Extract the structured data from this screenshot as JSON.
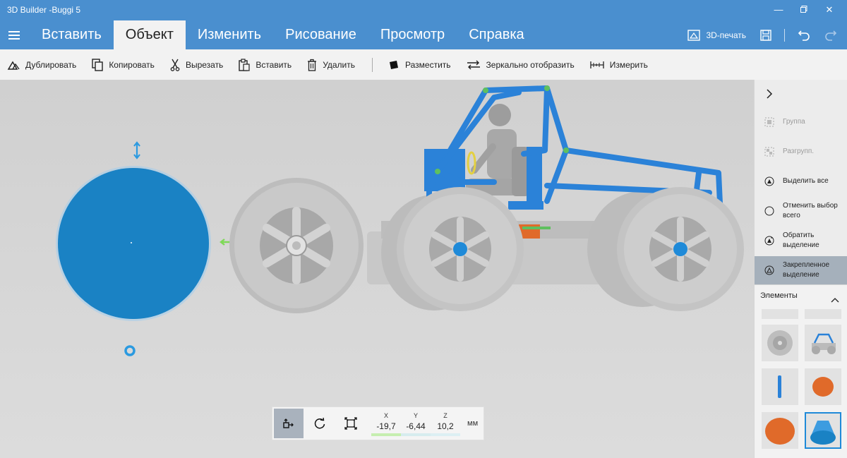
{
  "window": {
    "title": "3D Builder -Buggi 5"
  },
  "menu": {
    "tabs": [
      {
        "label": "Вставить"
      },
      {
        "label": "Объект",
        "active": true
      },
      {
        "label": "Изменить"
      },
      {
        "label": "Рисование"
      },
      {
        "label": "Просмотр"
      },
      {
        "label": "Справка"
      }
    ],
    "print_label": "3D-печать"
  },
  "toolbar": {
    "duplicate": "Дублировать",
    "copy": "Копировать",
    "cut": "Вырезать",
    "paste": "Вставить",
    "delete": "Удалить",
    "place": "Разместить",
    "mirror": "Зеркально отобразить",
    "measure": "Измерить"
  },
  "coords": {
    "x_label": "X",
    "x": "-19,7",
    "y_label": "Y",
    "y": "-6,44",
    "z_label": "Z",
    "z": "10,2",
    "unit": "мм"
  },
  "right_panel": {
    "group": "Группа",
    "ungroup": "Разгрупп.",
    "select_all": "Выделить все",
    "deselect_all": "Отменить выбор всего",
    "invert_selection": "Обратить выделение",
    "sticky_selection": "Закрепленное выделение",
    "elements_header": "Элементы"
  },
  "colors": {
    "title_bar": "#4a8fcf",
    "accent_blue": "#1f8ad8",
    "frame_blue": "#2b82d8",
    "orange": "#e06a2a",
    "green_handle": "#7ed957"
  },
  "icons": [
    "hamburger-icon",
    "printer-icon",
    "save-icon",
    "undo-icon",
    "redo-icon",
    "duplicate-icon",
    "copy-icon",
    "cut-icon",
    "paste-icon",
    "delete-icon",
    "place-icon",
    "mirror-icon",
    "measure-icon",
    "move-icon",
    "rotate-icon",
    "scale-icon",
    "chevron-right-icon",
    "chevron-up-icon"
  ]
}
